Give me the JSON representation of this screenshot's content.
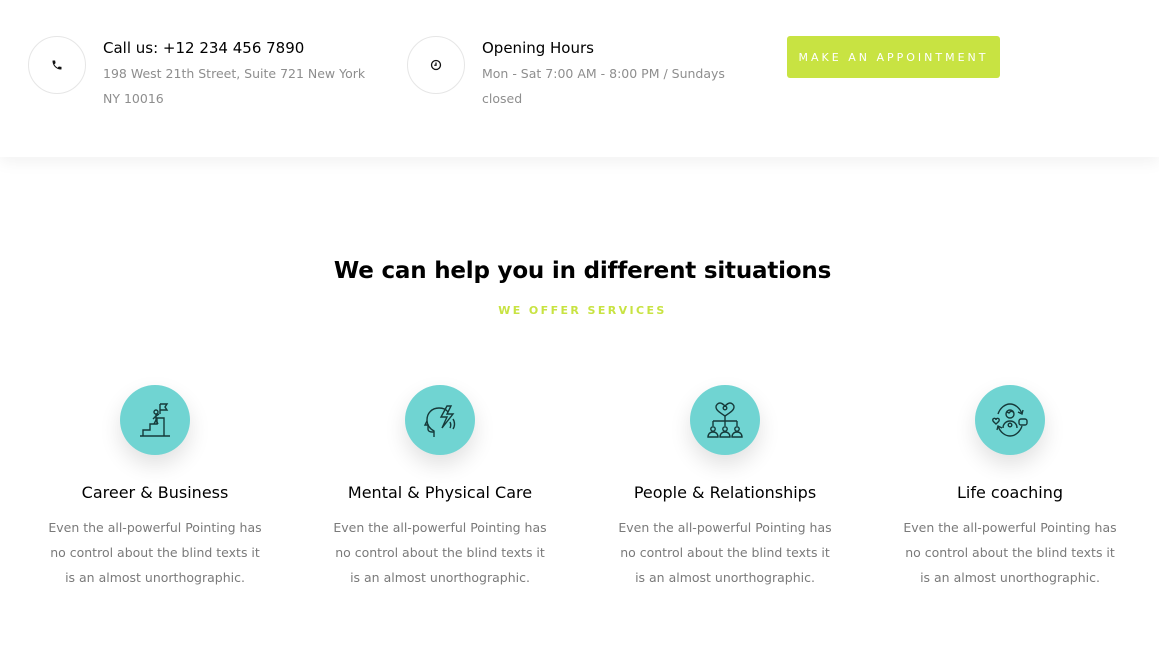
{
  "contact": {
    "phone_title": "Call us: +12 234 456 7890",
    "address": "198 West 21th Street, Suite 721 New York NY 10016",
    "phone_icon": "phone-icon",
    "hours_title": "Opening Hours",
    "hours_text": "Mon - Sat 7:00 AM - 8:00 PM / Sundays closed",
    "hours_icon": "clock-icon",
    "cta_label": "MAKE AN APPOINTMENT"
  },
  "section": {
    "heading": "We can help you in different situations",
    "subheading": "WE OFFER SERVICES"
  },
  "services": [
    {
      "title": "Career & Business",
      "desc": "Even the all-powerful Pointing has no control about the blind texts it is an almost unorthographic.",
      "icon": "career-climb-icon"
    },
    {
      "title": "Mental & Physical Care",
      "desc": "Even the all-powerful Pointing has no control about the blind texts it is an almost unorthographic.",
      "icon": "mind-head-icon"
    },
    {
      "title": "People & Relationships",
      "desc": "Even the all-powerful Pointing has no control about the blind texts it is an almost unorthographic.",
      "icon": "people-network-icon"
    },
    {
      "title": "Life coaching",
      "desc": "Even the all-powerful Pointing has no control about the blind texts it is an almost unorthographic.",
      "icon": "coaching-cycle-icon"
    }
  ],
  "colors": {
    "accent": "#c8e342",
    "icon_bg": "#70d4d2",
    "text_muted": "#8e8e8e"
  }
}
